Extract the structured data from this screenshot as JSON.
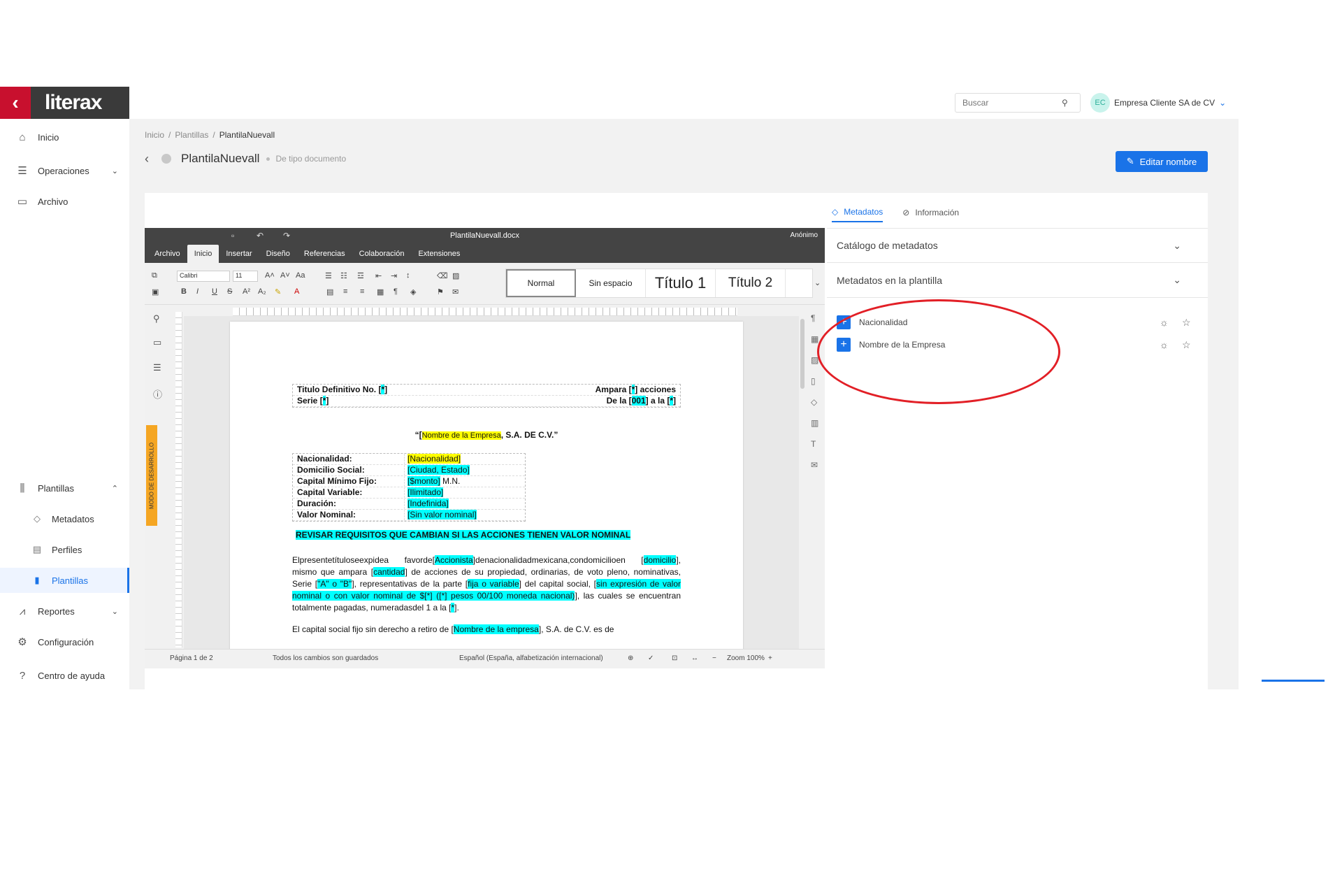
{
  "logo": {
    "text": "literax"
  },
  "sidebar": {
    "items": [
      {
        "label": "Inicio",
        "icon": "home-icon"
      },
      {
        "label": "Operaciones",
        "icon": "operations-icon"
      },
      {
        "label": "Archivo",
        "icon": "folder-icon"
      },
      {
        "label": "Plantillas",
        "icon": "library-icon"
      },
      {
        "label": "Metadatos",
        "icon": "tag-icon"
      },
      {
        "label": "Perfiles",
        "icon": "profile-icon"
      },
      {
        "label": "Plantillas",
        "icon": "document-icon"
      },
      {
        "label": "Reportes",
        "icon": "chart-icon"
      },
      {
        "label": "Configuración",
        "icon": "gear-icon"
      },
      {
        "label": "Centro de ayuda",
        "icon": "help-icon"
      }
    ]
  },
  "topbar": {
    "search_placeholder": "Buscar",
    "account_initials": "EC",
    "account_name": "Empresa Cliente SA de CV"
  },
  "breadcrumb": {
    "items": [
      "Inicio",
      "Plantillas",
      "PlantilaNuevall"
    ]
  },
  "page": {
    "title": "PlantilaNuevall",
    "subtitle": "De tipo documento",
    "edit_button": "Editar nombre"
  },
  "editor": {
    "filename": "PlantilaNuevall.docx",
    "user": "Anónimo",
    "menu": [
      "Archivo",
      "Inicio",
      "Insertar",
      "Diseño",
      "Referencias",
      "Colaboración",
      "Extensiones"
    ],
    "font_name": "Calibri",
    "font_size": "11",
    "styles": [
      "Normal",
      "Sin espacio",
      "Título 1",
      "Título 2"
    ],
    "dev_mode": "MODO DE DESARROLLO",
    "status": {
      "page": "Página 1 de 2",
      "saved": "Todos los cambios son guardados",
      "language": "Español (España, alfabetización internacional)",
      "zoom": "Zoom 100%"
    }
  },
  "document": {
    "t1_left_1": "Titulo Definitivo No. [",
    "t1_left_1_hl": "*",
    "t1_right_1a": "Ampara [",
    "t1_right_1_hl": "*",
    "t1_right_1b": "] acciones",
    "t1_left_2": "Serie [",
    "t1_left_2_hl": "*",
    "t1_right_2a": "De la [",
    "t1_right_2_hl": "001",
    "t1_right_2b": "] a la [",
    "t1_right_2_hl2": "*",
    "company_pre": "“[",
    "company_hl": "Nombre de la Empresa",
    "company_post": ", S.A. DE C.V.”",
    "fields": [
      {
        "k": "Nacionalidad:",
        "v": "[Nacionalidad]"
      },
      {
        "k": "Domicilio Social:",
        "v": "[Ciudad, Estado]"
      },
      {
        "k": "Capital Mínimo Fijo:",
        "v": "[$monto]",
        "suffix": " M.N."
      },
      {
        "k": "Capital Variable:",
        "v": "[Ilimitado]"
      },
      {
        "k": "Duración:",
        "v": "[Indefinida]"
      },
      {
        "k": "Valor Nominal:",
        "v": "[Sin valor nominal]"
      }
    ],
    "warning": "REVISAR REQUISITOS QUE CAMBIAN SI LAS ACCIONES TIENEN VALOR NOMINAL",
    "p1_a": "Elpresentetítuloseexpidea favorde[",
    "p1_hl1": "Accionista",
    "p1_b": "]denacionalidadmexicana,condomicilioen [",
    "p1_hl2": "domicilio",
    "p1_c": "], mismo que ampara [",
    "p1_hl3": "cantidad",
    "p1_d": "] de acciones de su propiedad, ordinarias, de voto pleno, nominativas, Serie [",
    "p1_hl4": "\"A\" o \"B\"",
    "p1_e": "], representativas de la parte [",
    "p1_hl5": "fija o variable",
    "p1_f": "] del capital social, [",
    "p1_hl6": "sin expresión de valor nominal o con valor nominal de $[*] ([*] pesos 00/100 moneda nacional)",
    "p1_g": "], las cuales se encuentran totalmente pagadas, numeradasdel 1 a la [",
    "p1_hl7": "*",
    "p1_h": "].",
    "p2_a": "El capital social fijo sin derecho a retiro de [",
    "p2_hl": "Nombre de la empresa",
    "p2_b": "], S.A. de C.V. es de"
  },
  "meta_panel": {
    "tabs": [
      "Metadatos",
      "Información"
    ],
    "sections": [
      "Catálogo de metadatos",
      "Metadatos en la plantilla"
    ],
    "items": [
      "Nacionalidad",
      "Nombre de la Empresa"
    ]
  },
  "colors": {
    "accent": "#1a73e8",
    "brand": "#c8102e",
    "highlight_cyan": "#00ffff",
    "highlight_yellow": "#ffff00",
    "annotation": "#e21f26"
  }
}
